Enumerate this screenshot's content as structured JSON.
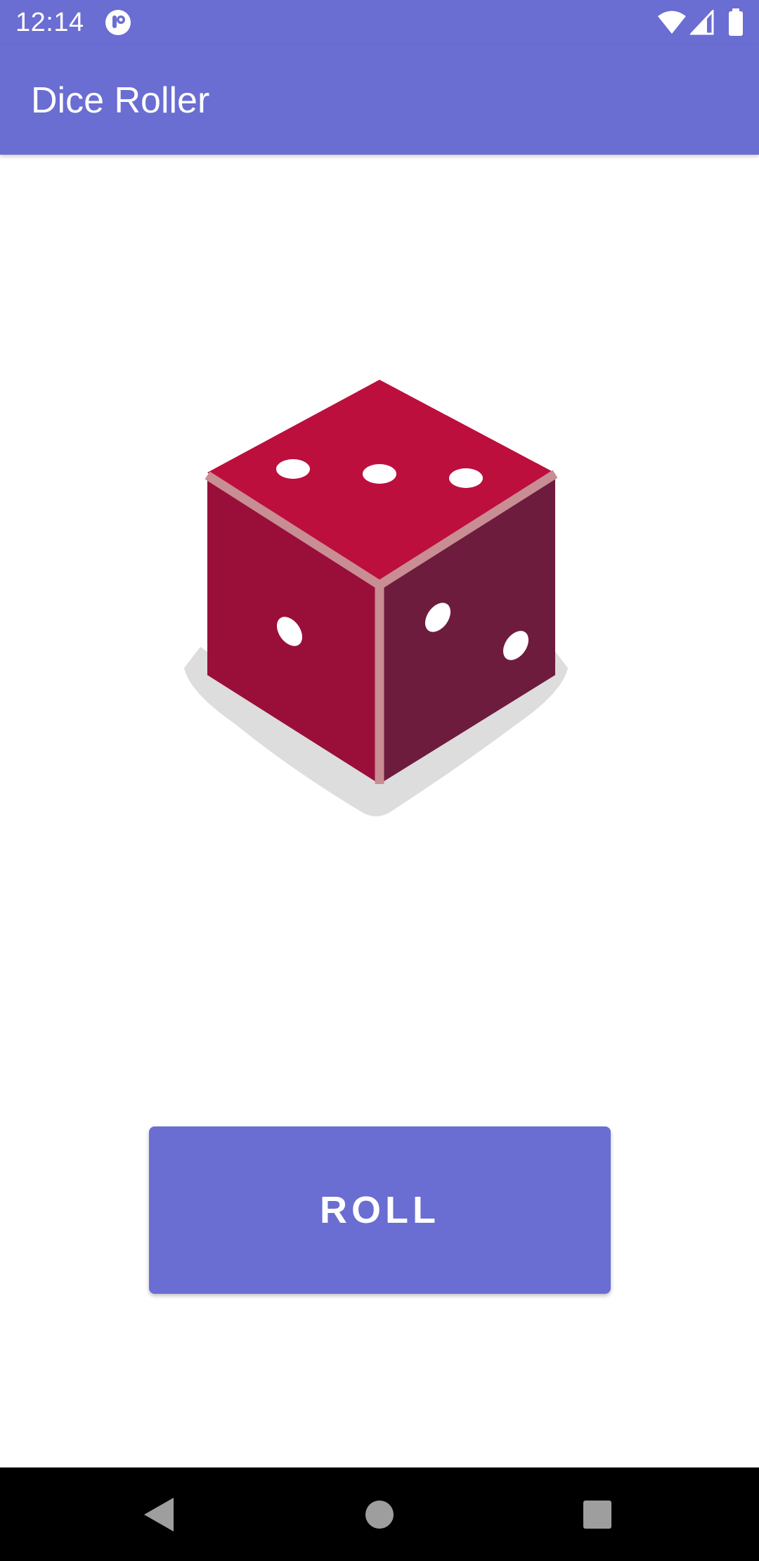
{
  "status_bar": {
    "time": "12:14",
    "icons": [
      "notification-app-icon",
      "wifi-icon",
      "signal-icon",
      "battery-icon"
    ]
  },
  "app_bar": {
    "title": "Dice Roller"
  },
  "dice": {
    "icon": "dice-icon",
    "top_face_pips": 3,
    "left_face_pips": 1,
    "right_face_pips": 2,
    "colors": {
      "top": "#bc0f3d",
      "left": "#9a0f3a",
      "right": "#6d1c3e",
      "edges": "#c98d94",
      "shadow": "#dddddd",
      "pips": "#ffffff"
    }
  },
  "roll_button": {
    "label": "ROLL"
  },
  "nav_bar": {
    "icons": [
      "back-icon",
      "home-icon",
      "recents-icon"
    ]
  },
  "colors": {
    "primary": "#6a6dd2",
    "background": "#ffffff",
    "nav": "#000000"
  }
}
